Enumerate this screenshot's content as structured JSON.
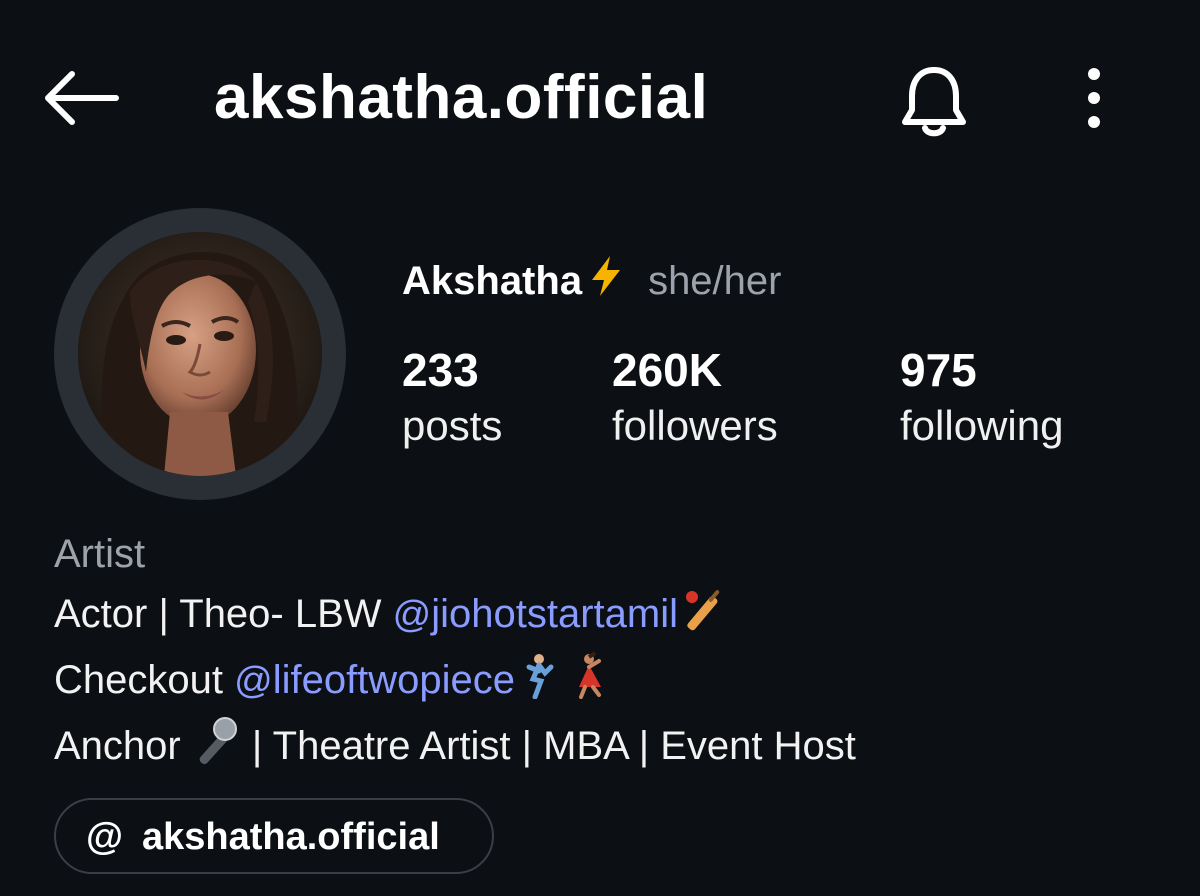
{
  "header": {
    "username": "akshatha.official",
    "back_icon": "arrow-left-icon",
    "bell_icon": "bell-icon",
    "more_icon": "more-vertical-icon"
  },
  "profile": {
    "display_name": "Akshatha",
    "name_emoji": "lightning-bolt-icon",
    "pronouns": "she/her",
    "stats": {
      "posts": {
        "value": "233",
        "label": "posts"
      },
      "followers": {
        "value": "260K",
        "label": "followers"
      },
      "following": {
        "value": "975",
        "label": "following"
      }
    }
  },
  "bio": {
    "category": "Artist",
    "line1": {
      "text": "Actor | Theo- LBW ",
      "mention_glyph": "@",
      "mention": "jiohotstartamil",
      "emoji": "cricket-bat-icon"
    },
    "line2": {
      "text": "Checkout ",
      "mention_glyph": "@",
      "mention": "lifeoftwopiece",
      "emoji": "dancers-icon"
    },
    "line3": {
      "prefix": "Anchor",
      "emoji": "microphone-icon",
      "suffix": " | Theatre Artist | MBA | Event Host"
    }
  },
  "threads_link": {
    "icon": "threads-icon",
    "glyph": "@",
    "label": "akshatha.official"
  },
  "colors": {
    "background": "#0c0f14",
    "mention": "#8a9cff",
    "secondary_text": "#9ea3ab",
    "bolt": "#f5b400"
  }
}
